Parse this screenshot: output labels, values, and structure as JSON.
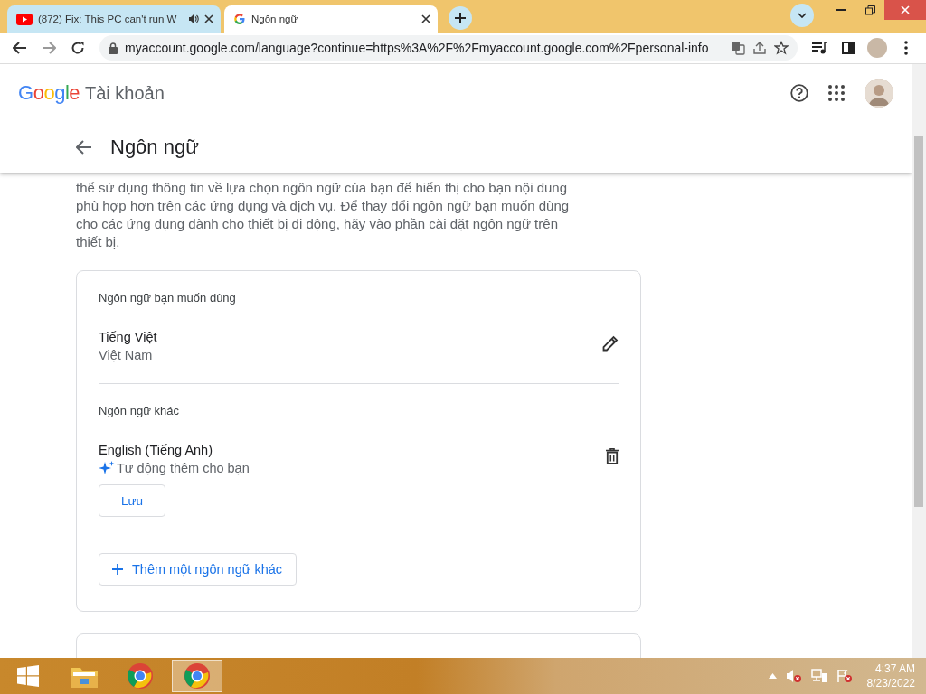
{
  "tabs": [
    {
      "title": "(872) Fix: This PC can't run W",
      "selected": false,
      "audio": true
    },
    {
      "title": "Ngôn ngữ",
      "selected": true,
      "audio": false
    }
  ],
  "address_bar": {
    "url": "myaccount.google.com/language?continue=https%3A%2F%2Fmyaccount.google.com%2Fpersonal-info"
  },
  "header": {
    "logo": "Google",
    "product": "Tài khoản"
  },
  "page_title": "Ngôn ngữ",
  "description": "thể sử dụng thông tin về lựa chọn ngôn ngữ của bạn để hiển thị cho bạn nội dung phù hợp hơn trên các ứng dụng và dịch vụ. Để thay đổi ngôn ngữ bạn muốn dùng cho các ứng dụng dành cho thiết bị di động, hãy vào phần cài đặt ngôn ngữ trên thiết bị.",
  "preferred": {
    "heading": "Ngôn ngữ bạn muốn dùng",
    "language": "Tiếng Việt",
    "region": "Việt Nam"
  },
  "other": {
    "heading": "Ngôn ngữ khác",
    "items": [
      {
        "language": "English (Tiếng Anh)",
        "note": "Tự động thêm cho bạn",
        "button": "Lưu"
      }
    ]
  },
  "add_button": "Thêm một ngôn ngữ khác",
  "clock": {
    "time": "4:37 AM",
    "date": "8/23/2022"
  }
}
